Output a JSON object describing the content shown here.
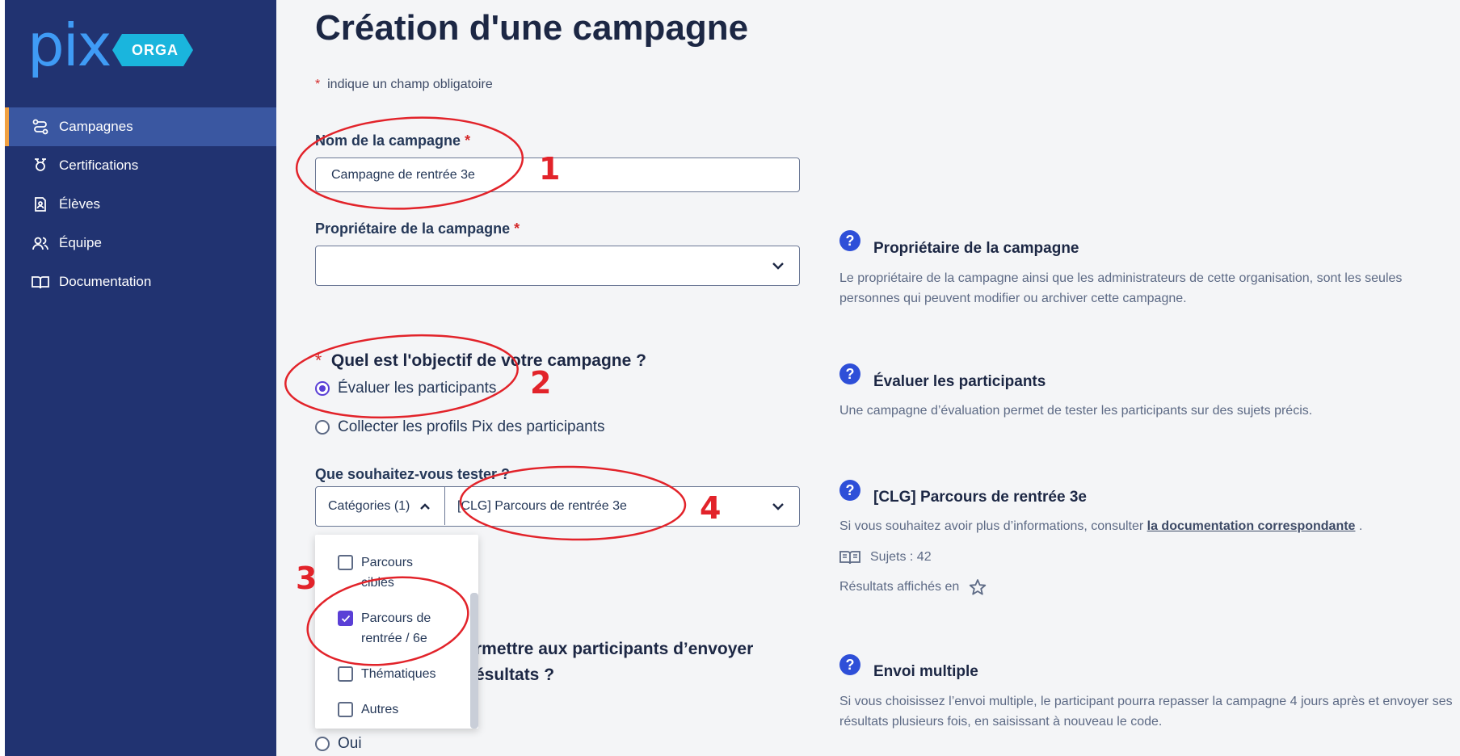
{
  "brand": {
    "logo_text": "pix",
    "badge": "ORGA"
  },
  "sidebar": {
    "items": [
      {
        "label": "Campagnes",
        "icon": "campaign-icon",
        "active": true
      },
      {
        "label": "Certifications",
        "icon": "certification-icon",
        "active": false
      },
      {
        "label": "Élèves",
        "icon": "student-icon",
        "active": false
      },
      {
        "label": "Équipe",
        "icon": "team-icon",
        "active": false
      },
      {
        "label": "Documentation",
        "icon": "book-icon",
        "active": false
      }
    ]
  },
  "page": {
    "title": "Création d'une campagne",
    "required_mark": "*",
    "required_note": "indique un champ obligatoire"
  },
  "form": {
    "name_label": "Nom de la campagne",
    "name_value": "Campagne de rentrée 3e",
    "owner_label": "Propriétaire de la campagne",
    "owner_value": "",
    "objective_question": "Quel est l'objectif de votre campagne ?",
    "objective_options": [
      "Évaluer les participants",
      "Collecter les profils Pix des participants"
    ],
    "objective_selected": 0,
    "test_label": "Que souhaitez-vous tester ?",
    "categories_button": "Catégories (1)",
    "test_value": "[CLG] Parcours de rentrée 3e",
    "category_options": [
      {
        "label_line1": "Parcours",
        "label_line2": "cibles",
        "checked": false
      },
      {
        "label_line1": "Parcours de",
        "label_line2": "rentrée / 6e",
        "checked": true
      },
      {
        "label_line1": "Thématiques",
        "label_line2": "",
        "checked": false
      },
      {
        "label_line1": "Autres",
        "label_line2": "",
        "checked": false
      }
    ],
    "multiple_question_line1": "rmettre aux participants d’envoyer",
    "multiple_question_line2": "ésultats ?",
    "multiple_yes": "Oui"
  },
  "help": {
    "owner_title": "Propriétaire de la campagne",
    "owner_text": "Le propriétaire de la campagne ainsi que les administrateurs de cette organisation, sont les seules personnes qui peuvent modifier ou archiver cette campagne.",
    "eval_title": "Évaluer les participants",
    "eval_text": "Une campagne d’évaluation permet de tester les participants sur des sujets précis.",
    "target_title": "[CLG] Parcours de rentrée 3e",
    "target_text_prefix": "Si vous souhaitez avoir plus d’informations, consulter",
    "target_link": "la documentation correspondante",
    "target_text_suffix": ".",
    "subjects": "Sujets : 42",
    "results_label": "Résultats affichés en",
    "multiple_title": "Envoi multiple",
    "multiple_text": "Si vous choisissez l’envoi multiple, le participant pourra repasser la campagne 4 jours après et envoyer ses résultats plusieurs fois, en saisissant à nouveau le code."
  },
  "annotations": [
    "1",
    "2",
    "3",
    "4"
  ],
  "colors": {
    "sidebar": "#213371",
    "active_item": "#3a57a1",
    "accent": "#f1a141",
    "annotation": "#e2232a",
    "primary": "#5a3fd6"
  }
}
